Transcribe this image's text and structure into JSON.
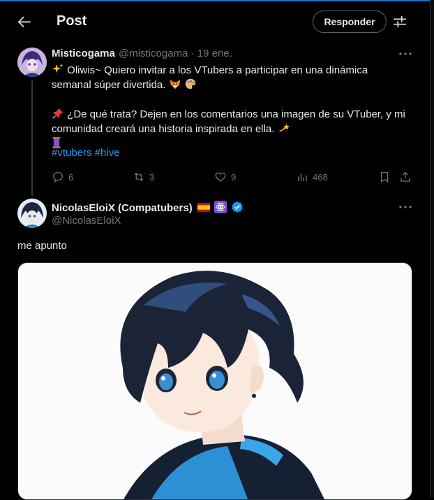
{
  "header": {
    "title": "Post",
    "reply_button": "Responder"
  },
  "post": {
    "author_name": "Misticogama",
    "author_handle": "@misticogama",
    "date": "· 19 ene.",
    "line1": "Oliwis~ Quiero invitar a los VTubers a participar en una dinámica",
    "line2": "semanal súper divertida.",
    "line3": "¿De qué trata? Dejen en los comentarios una imagen de su VTuber, y mi",
    "line4": "comunidad creará una historia inspirada en ella.",
    "hashtags": "#vtubers #hive",
    "stats": {
      "replies": "6",
      "reposts": "3",
      "likes": "9",
      "views": "468"
    }
  },
  "reply": {
    "author_name": "NicolasEloiX (Compatubers)",
    "author_handle": "@NicolasEloiX",
    "text": "me apunto"
  },
  "icons": {
    "back": "arrow-left-icon",
    "filter": "sliders-icon",
    "more": "more-dots-icon",
    "reply": "comment-icon",
    "repost": "repost-icon",
    "like": "heart-icon",
    "views": "analytics-icon",
    "bookmark": "bookmark-icon",
    "share": "share-icon"
  },
  "colors": {
    "background": "#000000",
    "link": "#1d9bf0",
    "muted": "#71767b",
    "verified": "#1d9bf0"
  }
}
